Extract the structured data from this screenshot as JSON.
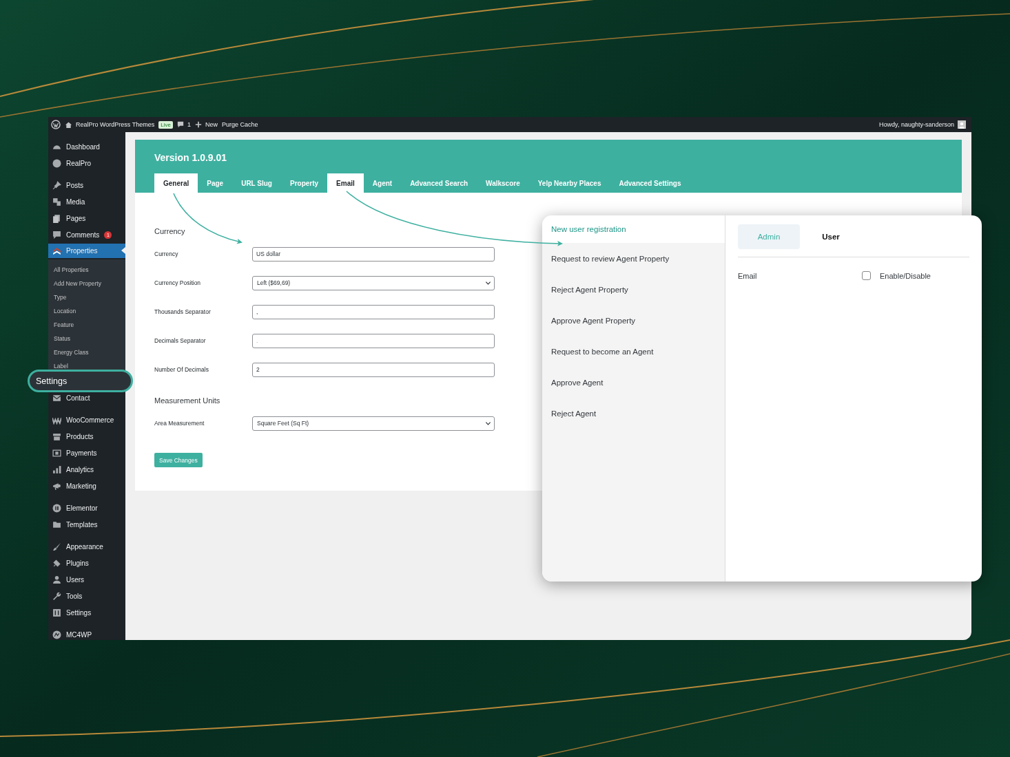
{
  "admin_bar": {
    "site_name": "RealPro WordPress Themes",
    "live_badge": "Live",
    "comments_count": "1",
    "new_label": "New",
    "purge_cache": "Purge Cache",
    "greeting": "Howdy, naughty-sanderson"
  },
  "sidebar": {
    "groups": [
      [
        {
          "label": "Dashboard",
          "selected": false
        },
        {
          "label": "RealPro",
          "selected": false
        }
      ],
      [
        {
          "label": "Posts",
          "selected": false
        },
        {
          "label": "Media",
          "selected": false
        },
        {
          "label": "Pages",
          "selected": false
        },
        {
          "label": "Comments",
          "selected": false,
          "badge": "1"
        },
        {
          "label": "Properties",
          "selected": true,
          "children": [
            {
              "label": "All Properties"
            },
            {
              "label": "Add New Property"
            },
            {
              "label": "Type"
            },
            {
              "label": "Location"
            },
            {
              "label": "Feature"
            },
            {
              "label": "Status"
            },
            {
              "label": "Energy Class"
            },
            {
              "label": "Label"
            }
          ]
        },
        {
          "label": "Contact",
          "selected": false
        }
      ],
      [
        {
          "label": "WooCommerce",
          "selected": false
        },
        {
          "label": "Products",
          "selected": false
        },
        {
          "label": "Payments",
          "selected": false
        },
        {
          "label": "Analytics",
          "selected": false
        },
        {
          "label": "Marketing",
          "selected": false
        }
      ],
      [
        {
          "label": "Elementor",
          "selected": false
        },
        {
          "label": "Templates",
          "selected": false
        }
      ],
      [
        {
          "label": "Appearance",
          "selected": false
        },
        {
          "label": "Plugins",
          "selected": false
        },
        {
          "label": "Users",
          "selected": false
        },
        {
          "label": "Tools",
          "selected": false
        },
        {
          "label": "Settings",
          "selected": false
        }
      ],
      [
        {
          "label": "MC4WP",
          "selected": false
        }
      ]
    ]
  },
  "callout": {
    "label": "Settings"
  },
  "panel": {
    "title": "Version 1.0.9.01",
    "tabs": [
      {
        "label": "General",
        "selected": true
      },
      {
        "label": "Page",
        "selected": false
      },
      {
        "label": "URL Slug",
        "selected": false
      },
      {
        "label": "Property",
        "selected": false
      },
      {
        "label": "Email",
        "selected": true
      },
      {
        "label": "Agent",
        "selected": false
      },
      {
        "label": "Advanced Search",
        "selected": false
      },
      {
        "label": "Walkscore",
        "selected": false
      },
      {
        "label": "Yelp Nearby Places",
        "selected": false
      },
      {
        "label": "Advanced Settings",
        "selected": false
      }
    ],
    "sections": [
      {
        "heading": "Currency",
        "fields": [
          {
            "label": "Currency",
            "kind": "text",
            "value": "US dollar"
          },
          {
            "label": "Currency Position",
            "kind": "select",
            "value": "Left ($69,69)"
          },
          {
            "label": "Thousands Separator",
            "kind": "text",
            "value": ","
          },
          {
            "label": "Decimals Separator",
            "kind": "text",
            "placeholder": "."
          },
          {
            "label": "Number Of Decimals",
            "kind": "text",
            "value": "2"
          }
        ]
      },
      {
        "heading": "Measurement Units",
        "fields": [
          {
            "label": "Area Measurement",
            "kind": "select",
            "value": "Square Feet (Sq Ft)"
          }
        ]
      }
    ],
    "save_button": "Save Changes"
  },
  "email_popup": {
    "events": [
      {
        "label": "New user registration",
        "selected": true
      },
      {
        "label": "Request to review Agent Property",
        "selected": false
      },
      {
        "label": "Reject Agent Property",
        "selected": false
      },
      {
        "label": "Approve Agent Property",
        "selected": false
      },
      {
        "label": "Request to become an Agent",
        "selected": false
      },
      {
        "label": "Approve Agent",
        "selected": false
      },
      {
        "label": "Reject Agent",
        "selected": false
      }
    ],
    "recipient_tabs": [
      {
        "label": "Admin",
        "selected": true
      },
      {
        "label": "User",
        "selected": false
      }
    ],
    "settings": [
      {
        "label": "Email",
        "option": "Enable/Disable",
        "checked": false
      }
    ]
  }
}
